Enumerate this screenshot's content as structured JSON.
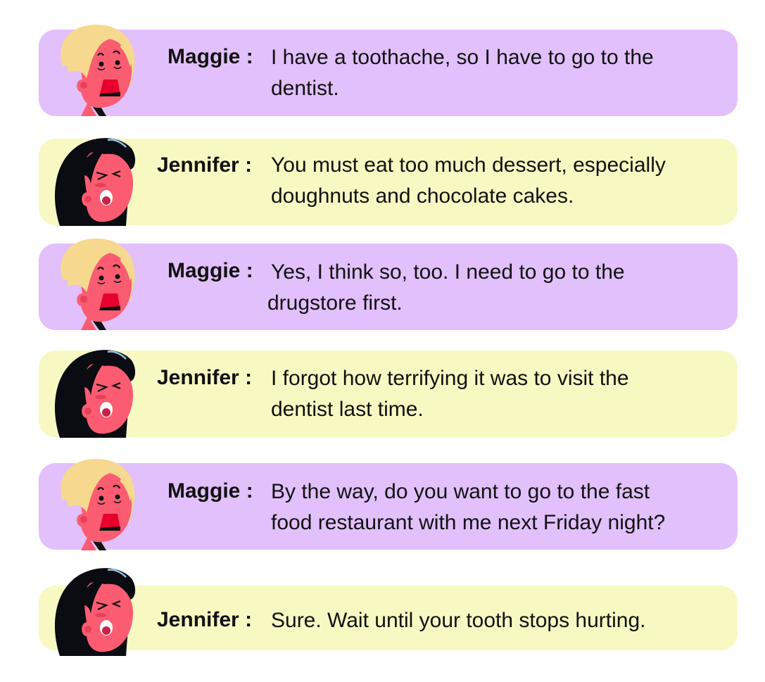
{
  "dialogue": [
    {
      "speaker": "Maggie",
      "separator": ":",
      "lines": [
        "I have a toothache, so I have to go to the",
        "dentist."
      ]
    },
    {
      "speaker": "Jennifer",
      "separator": ":",
      "lines": [
        "You must eat too much dessert, especially",
        "doughnuts and chocolate cakes."
      ]
    },
    {
      "speaker": "Maggie",
      "separator": ":",
      "lines": [
        "Yes, I think so, too. I need to go to the",
        "drugstore first."
      ]
    },
    {
      "speaker": "Jennifer",
      "separator": ":",
      "lines": [
        "I forgot how terrifying it was to visit the",
        "dentist last time."
      ]
    },
    {
      "speaker": "Maggie",
      "separator": ":",
      "lines": [
        "By the way, do you want to go to the fast",
        "food restaurant with me next Friday night?"
      ]
    },
    {
      "speaker": "Jennifer",
      "separator": ":",
      "lines": [
        "Sure. Wait until your tooth stops hurting."
      ]
    }
  ],
  "colors": {
    "maggie_bubble": "#e2c0fb",
    "jennifer_bubble": "#f8f9c2",
    "skin": "#fb5c72",
    "maggie_hair": "#f6d98e",
    "jennifer_hair": "#0b0b12",
    "maggie_mouth": "#e8002e",
    "jennifer_mouth": "#ffffff"
  },
  "avatars": {
    "maggie": "maggie-avatar",
    "jennifer": "jennifer-avatar"
  }
}
